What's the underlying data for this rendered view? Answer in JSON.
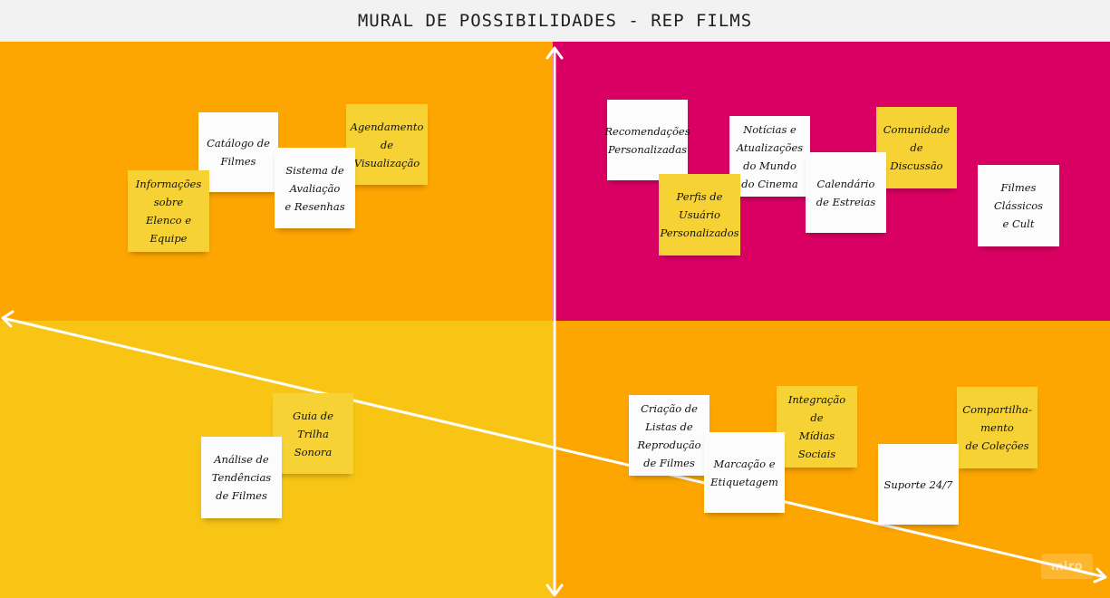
{
  "board": {
    "title": "MURAL DE POSSIBILIDADES - REP FILMS",
    "quadrant_colors": {
      "top_left": "#fda602",
      "top_right": "#da0063",
      "bottom_left": "#f8c514",
      "bottom_right": "#fda602"
    },
    "sticky_colors": {
      "white": "#fcfcfc",
      "yellow": "#f6d235"
    }
  },
  "notes": {
    "catalogo": "Catálogo de\nFilmes",
    "agendamento": "Agendamento\nde\nVisualização",
    "sistema": "Sistema de\nAvaliação\ne Resenhas",
    "informacoes": "Informações\nsobre\nElenco e\nEquipe",
    "recomendacoes": "Recomendações\nPersonalizadas",
    "noticias": "Notícias e\nAtualizações\ndo Mundo\ndo Cinema",
    "comunidade": "Comunidade de\nDiscussão",
    "perfis": "Perfis de\nUsuário\nPersonalizados",
    "calendario": "Calendário\nde Estreias",
    "classicos": "Filmes\nClássicos\ne Cult",
    "guia": "Guia de Trilha\nSonora",
    "analise": "Análise de\nTendências\nde Filmes",
    "criacao": "Criação de\nListas de\nReprodução\nde Filmes",
    "integracao": "Integração\nde\nMídias Sociais",
    "compartilhamento": "Compartilha-\nmento\nde Coleções",
    "marcacao": "Marcação e\nEtiquetagem",
    "suporte": "Suporte 24/7"
  },
  "watermark": "miro"
}
